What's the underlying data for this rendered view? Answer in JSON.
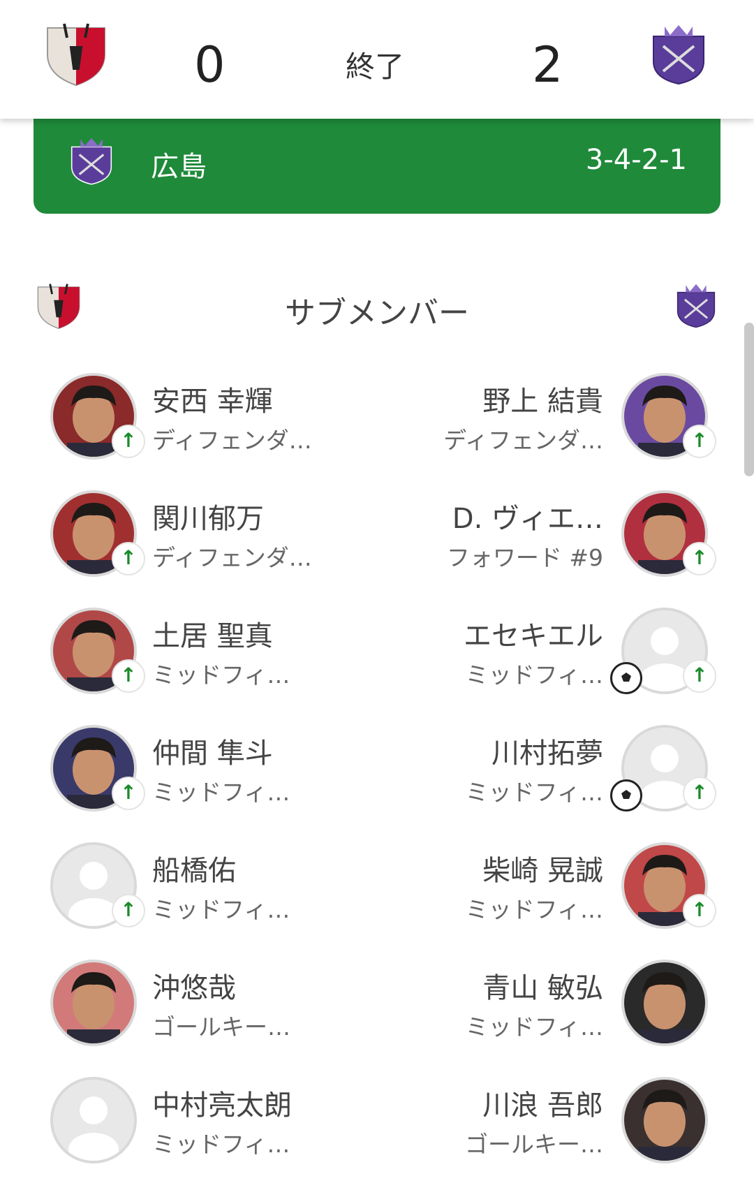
{
  "header": {
    "home_score": "0",
    "status": "終了",
    "away_score": "2"
  },
  "team_bar": {
    "team_name": "広島",
    "formation": "3-4-2-1",
    "color": "#1f8a3a"
  },
  "subs": {
    "title": "サブメンバー",
    "home": [
      {
        "name": "安西 幸輝",
        "position": "ディフェンダ…",
        "photo": true,
        "sub_in": true
      },
      {
        "name": "関川郁万",
        "position": "ディフェンダ…",
        "photo": true,
        "sub_in": true
      },
      {
        "name": "土居 聖真",
        "position": "ミッドフィ…",
        "photo": true,
        "sub_in": true
      },
      {
        "name": "仲間 隼斗",
        "position": "ミッドフィ…",
        "photo": true,
        "sub_in": true
      },
      {
        "name": "船橋佑",
        "position": "ミッドフィ…",
        "photo": false,
        "sub_in": true
      },
      {
        "name": "沖悠哉",
        "position": "ゴールキー…",
        "photo": true,
        "sub_in": false
      },
      {
        "name": "中村亮太朗",
        "position": "ミッドフィ…",
        "photo": false,
        "sub_in": false
      }
    ],
    "away": [
      {
        "name": "野上 結貴",
        "position": "ディフェンダ…",
        "photo": true,
        "sub_in": true,
        "goal": false
      },
      {
        "name": "D. ヴィエ…",
        "position": "フォワード #9",
        "photo": true,
        "sub_in": true,
        "goal": false
      },
      {
        "name": "エセキエル",
        "position": "ミッドフィ…",
        "photo": false,
        "sub_in": true,
        "goal": true
      },
      {
        "name": "川村拓夢",
        "position": "ミッドフィ…",
        "photo": false,
        "sub_in": true,
        "goal": true
      },
      {
        "name": "柴崎 晃誠",
        "position": "ミッドフィ…",
        "photo": true,
        "sub_in": true,
        "goal": false
      },
      {
        "name": "青山 敏弘",
        "position": "ミッドフィ…",
        "photo": true,
        "sub_in": false,
        "goal": false
      },
      {
        "name": "川浪 吾郎",
        "position": "ゴールキー…",
        "photo": true,
        "sub_in": false,
        "goal": false
      }
    ]
  },
  "icons": {
    "sub_in": "↑",
    "home_crest": "kashima-crest-icon",
    "away_crest": "hiroshima-crest-icon"
  },
  "colors": {
    "home_red": "#c8102e",
    "away_purple": "#5a3d9a",
    "sub_green": "#1a8a2a"
  }
}
